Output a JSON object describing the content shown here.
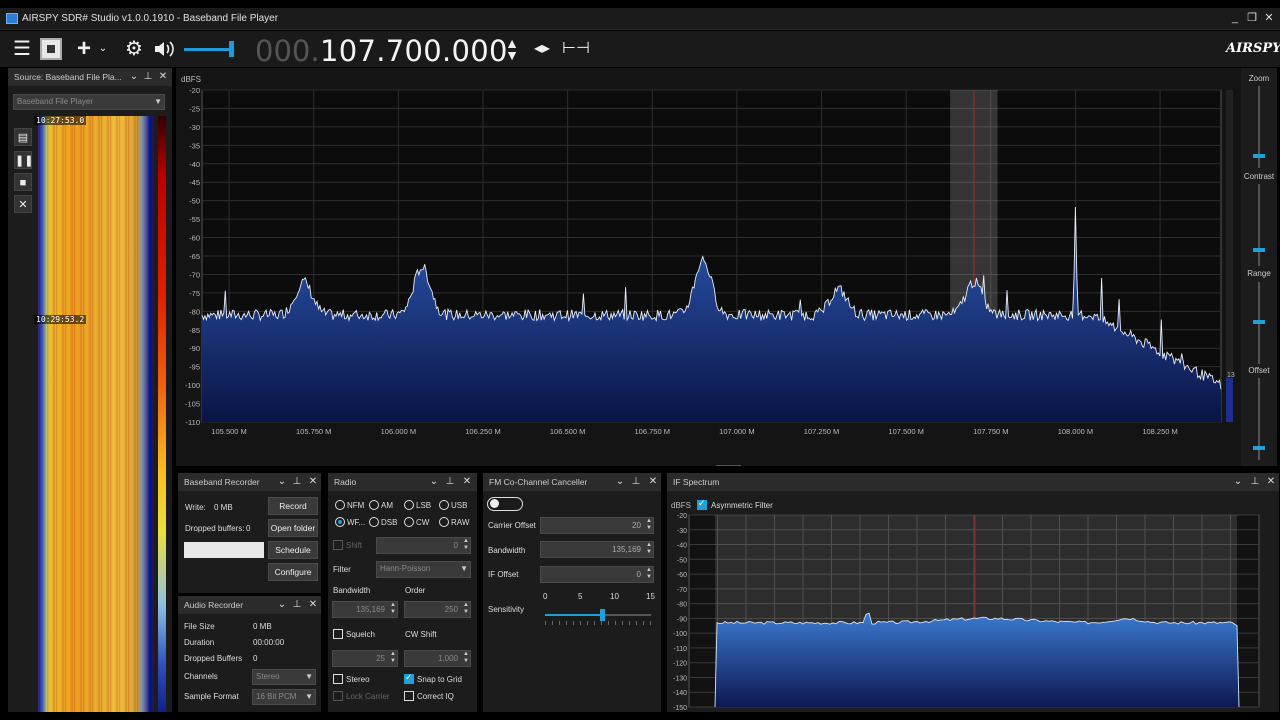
{
  "window": {
    "title": "AIRSPY SDR# Studio v1.0.0.1910 - Baseband File Player",
    "controls": [
      "_",
      "❐",
      "✕"
    ]
  },
  "toolbar": {
    "frequency_prefix": "000.",
    "frequency": "107.700.000",
    "volume_level": 0.9,
    "logo": "AIRSPY"
  },
  "source": {
    "title": "Source: Baseband File Pla...",
    "selection": "Baseband File Player",
    "timestamps": [
      "10:27:53.0",
      "10:29:53.2"
    ]
  },
  "spectrum": {
    "y_unit": "dBFS",
    "y_ticks": [
      "-20",
      "-25",
      "-30",
      "-35",
      "-40",
      "-45",
      "-50",
      "-55",
      "-60",
      "-65",
      "-70",
      "-75",
      "-80",
      "-85",
      "-90",
      "-95",
      "-100",
      "-105",
      "-110"
    ],
    "x_ticks": [
      "105.500 M",
      "105.750 M",
      "106.000 M",
      "106.250 M",
      "106.500 M",
      "106.750 M",
      "107.000 M",
      "107.250 M",
      "107.500 M",
      "107.750 M",
      "108.000 M",
      "108.250 M"
    ],
    "x_min_mhz": 105.42,
    "x_max_mhz": 108.43,
    "y_min_db": -110,
    "y_max_db": -20,
    "tuned_mhz": 107.7,
    "filter_low_mhz": 107.63,
    "filter_high_mhz": 107.77,
    "side_value": "13",
    "peaks": [
      {
        "mhz": 105.72,
        "db": -72
      },
      {
        "mhz": 106.07,
        "db": -68
      },
      {
        "mhz": 106.9,
        "db": -66
      },
      {
        "mhz": 107.3,
        "db": -74
      },
      {
        "mhz": 107.7,
        "db": -72
      },
      {
        "mhz": 108.0,
        "db": -53
      }
    ]
  },
  "zoom": {
    "labels": [
      "Zoom",
      "Contrast",
      "Range",
      "Offset"
    ]
  },
  "baseband_recorder": {
    "title": "Baseband Recorder",
    "write_label": "Write:",
    "write_value": "0 MB",
    "dropped_label": "Dropped buffers:",
    "dropped_value": "0",
    "buttons": [
      "Record",
      "Open folder",
      "Schedule",
      "Configure"
    ]
  },
  "audio_recorder": {
    "title": "Audio Recorder",
    "rows": [
      {
        "label": "File Size",
        "value": "0 MB"
      },
      {
        "label": "Duration",
        "value": "00:00:00"
      },
      {
        "label": "Dropped Buffers",
        "value": "0"
      },
      {
        "label": "Channels",
        "value": "Stereo"
      },
      {
        "label": "Sample Format",
        "value": "16 Bit PCM"
      }
    ]
  },
  "radio": {
    "title": "Radio",
    "modes": [
      "NFM",
      "AM",
      "LSB",
      "USB",
      "WF...",
      "DSB",
      "CW",
      "RAW"
    ],
    "selected_mode": "WF...",
    "shift_label": "Shift",
    "shift_value": "0",
    "filter_label": "Filter",
    "filter_value": "Hann-Poisson",
    "bandwidth_label": "Bandwidth",
    "bandwidth_value": "135,169",
    "order_label": "Order",
    "order_value": "250",
    "squelch_label": "Squelch",
    "squelch_value": "25",
    "cwshift_label": "CW Shift",
    "cwshift_value": "1,000",
    "stereo_label": "Stereo",
    "snap_label": "Snap to Grid",
    "lock_label": "Lock Carrier",
    "correctiq_label": "Correct IQ"
  },
  "fm_canceller": {
    "title": "FM Co-Channel Canceller",
    "carrier_offset_label": "Carrier Offset",
    "carrier_offset_value": "20",
    "bandwidth_label": "Bandwidth",
    "bandwidth_value": "135,169",
    "if_offset_label": "IF Offset",
    "if_offset_value": "0",
    "sensitivity_label": "Sensitivity",
    "sensitivity_ticks": [
      "0",
      "5",
      "10",
      "15"
    ],
    "sensitivity_value": 8
  },
  "if_spectrum": {
    "title": "IF Spectrum",
    "y_unit": "dBFS",
    "asym_label": "Asymmetric Filter",
    "y_ticks": [
      "-20",
      "-30",
      "-40",
      "-50",
      "-60",
      "-70",
      "-80",
      "-90",
      "-100",
      "-110",
      "-120",
      "-130",
      "-140",
      "-150"
    ]
  }
}
